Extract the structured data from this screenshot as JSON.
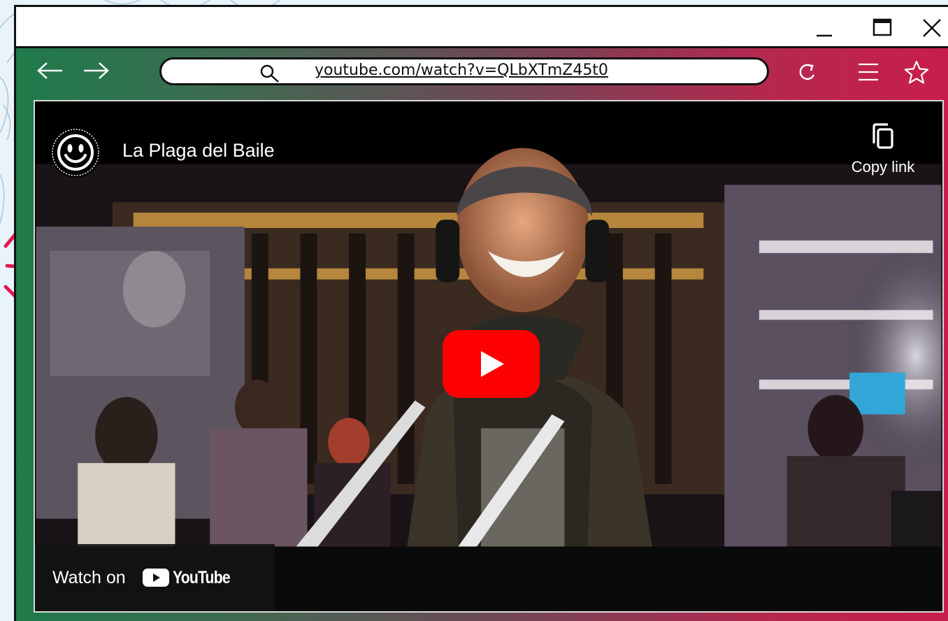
{
  "window": {
    "minimize_icon": "minimize-icon",
    "maximize_icon": "maximize-icon",
    "close_icon": "close-icon"
  },
  "toolbar": {
    "back_icon": "arrow-left-icon",
    "forward_icon": "arrow-right-icon",
    "url": "youtube.com/watch?v=QLbXTmZ45t0",
    "reload_icon": "reload-icon",
    "menu_icon": "hamburger-icon",
    "bookmark_icon": "star-icon"
  },
  "video": {
    "channel_avatar_icon": "smiley-icon",
    "title": "La Plaga del Baile",
    "copy_link_label": "Copy link",
    "copy_link_icon": "copy-icon",
    "play_icon": "youtube-play-icon",
    "watch_on_label": "Watch on",
    "youtube_label": "YouTube"
  },
  "colors": {
    "gradient_start": "#1f7a4a",
    "gradient_end": "#c81e4c",
    "youtube_red": "#ff0000",
    "player_bg": "#000000"
  }
}
